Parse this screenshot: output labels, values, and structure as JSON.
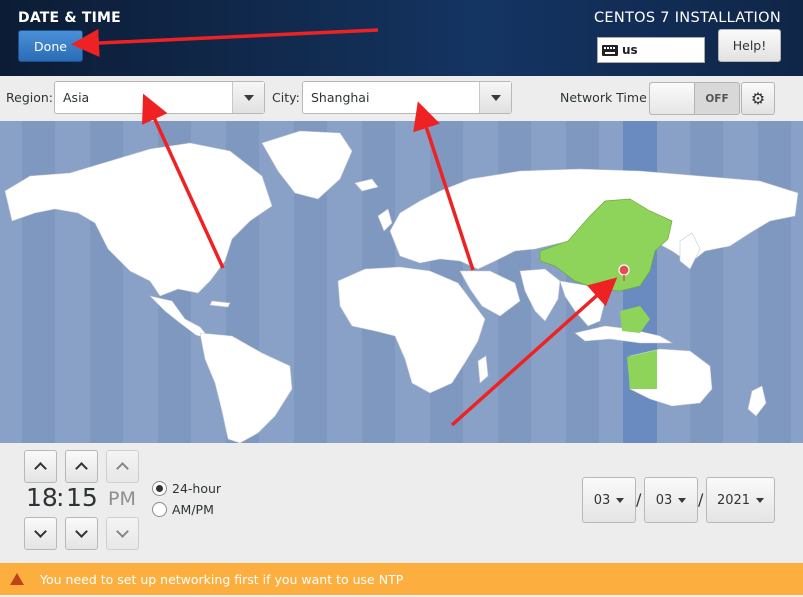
{
  "header": {
    "page_title": "DATE & TIME",
    "product_title": "CENTOS 7 INSTALLATION",
    "done_label": "Done",
    "keyboard_layout": "us",
    "help_label": "Help!",
    "icons": [
      "keyboard-icon"
    ]
  },
  "toolbar": {
    "region_label": "Region:",
    "region_value": "Asia",
    "city_label": "City:",
    "city_value": "Shanghai",
    "network_time_label": "Network Time",
    "network_time_state": "OFF",
    "icons": [
      "gear-icon",
      "chevron-down-icon"
    ]
  },
  "map": {
    "selected_country": "China",
    "colors": {
      "ocean": "#8aa1c7",
      "land": "#ffffff",
      "selected": "#8fd45a",
      "timezone_band": "#6a8bc0",
      "pin": "#e05050"
    }
  },
  "time": {
    "hours": "18",
    "separator": ":",
    "minutes": "15",
    "ampm": "PM",
    "format_24_label": "24-hour",
    "format_ampm_label": "AM/PM",
    "format_selected": "24-hour"
  },
  "date": {
    "month": "03",
    "day": "03",
    "year": "2021",
    "separator": "/"
  },
  "warning": {
    "text": "You need to set up networking first if you want to use NTP",
    "color": "#fcaf3e"
  },
  "annotations": {
    "arrow_color": "#ee2222"
  }
}
